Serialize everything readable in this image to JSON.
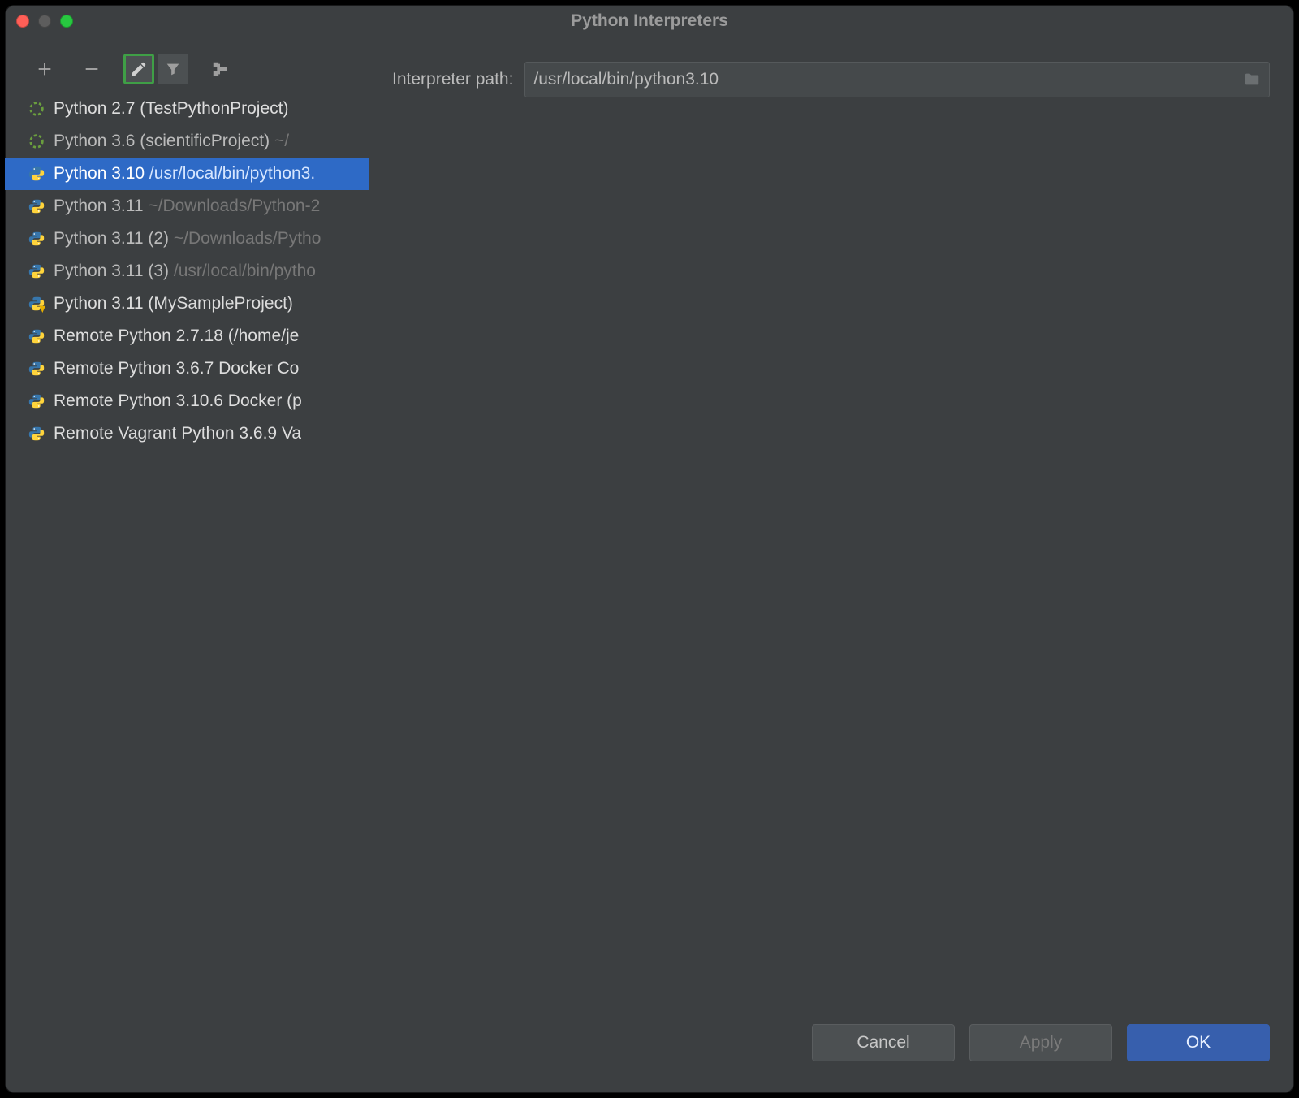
{
  "window": {
    "title": "Python Interpreters"
  },
  "detail": {
    "label": "Interpreter path:",
    "value": "/usr/local/bin/python3.10"
  },
  "interpreters": [
    {
      "icon": "ring",
      "name": "Python 2.7 (TestPythonProject)",
      "path": ""
    },
    {
      "icon": "ring",
      "name": "Python 3.6 (scientificProject)",
      "path": " ~/"
    },
    {
      "icon": "python",
      "name": "Python 3.10",
      "path": " /usr/local/bin/python3.",
      "selected": true
    },
    {
      "icon": "python",
      "name": "Python 3.11",
      "path": " ~/Downloads/Python-2"
    },
    {
      "icon": "python",
      "name": "Python 3.11 (2)",
      "path": " ~/Downloads/Pytho"
    },
    {
      "icon": "python",
      "name": "Python 3.11 (3)",
      "path": " /usr/local/bin/pytho"
    },
    {
      "icon": "pyv",
      "name": "Python 3.11 (MySampleProject)",
      "path": ""
    },
    {
      "icon": "python",
      "name": "Remote Python 2.7.18 (/home/je",
      "path": ""
    },
    {
      "icon": "python",
      "name": "Remote Python 3.6.7 Docker Co",
      "path": ""
    },
    {
      "icon": "python",
      "name": "Remote Python 3.10.6 Docker (p",
      "path": ""
    },
    {
      "icon": "python",
      "name": "Remote Vagrant Python 3.6.9 Va",
      "path": ""
    }
  ],
  "footer": {
    "cancel": "Cancel",
    "apply": "Apply",
    "ok": "OK"
  }
}
